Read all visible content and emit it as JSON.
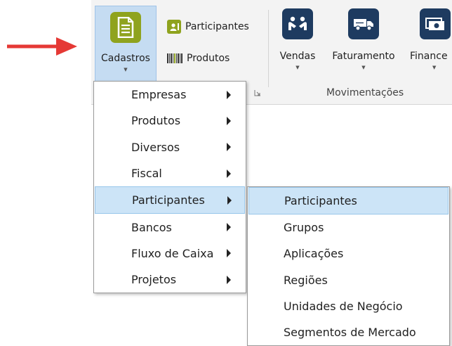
{
  "ribbon": {
    "cadastros": {
      "label": "Cadastros",
      "icon": "document-icon",
      "color": "#8fa31e"
    },
    "participantes_small": {
      "label": "Participantes",
      "icon": "contact-card-icon"
    },
    "produtos_small": {
      "label": "Produtos",
      "icon": "barcode-icon"
    },
    "vendas": {
      "label": "Vendas",
      "icon": "handshake-icon"
    },
    "faturamento": {
      "label": "Faturamento",
      "icon": "truck-icon"
    },
    "financeiro": {
      "label": "Finance",
      "icon": "money-icon"
    },
    "movimentacoes_group_label": "Movimentações",
    "navy_color": "#1e3b60"
  },
  "cadastros_menu": {
    "items": [
      {
        "label": "Empresas",
        "has_submenu": true
      },
      {
        "label": "Produtos",
        "has_submenu": true
      },
      {
        "label": "Diversos",
        "has_submenu": true
      },
      {
        "label": "Fiscal",
        "has_submenu": true
      },
      {
        "label": "Participantes",
        "has_submenu": true,
        "highlighted": true
      },
      {
        "label": "Bancos",
        "has_submenu": true
      },
      {
        "label": "Fluxo de Caixa",
        "has_submenu": true
      },
      {
        "label": "Projetos",
        "has_submenu": true
      }
    ]
  },
  "participantes_submenu": {
    "items": [
      {
        "label": "Participantes",
        "highlighted": true
      },
      {
        "label": "Grupos"
      },
      {
        "label": "Aplicações"
      },
      {
        "label": "Regiões"
      },
      {
        "label": "Unidades de Negócio"
      },
      {
        "label": "Segmentos de Mercado"
      }
    ]
  },
  "highlight_color": "#cce4f7",
  "annotation_arrow_color": "#e53935"
}
